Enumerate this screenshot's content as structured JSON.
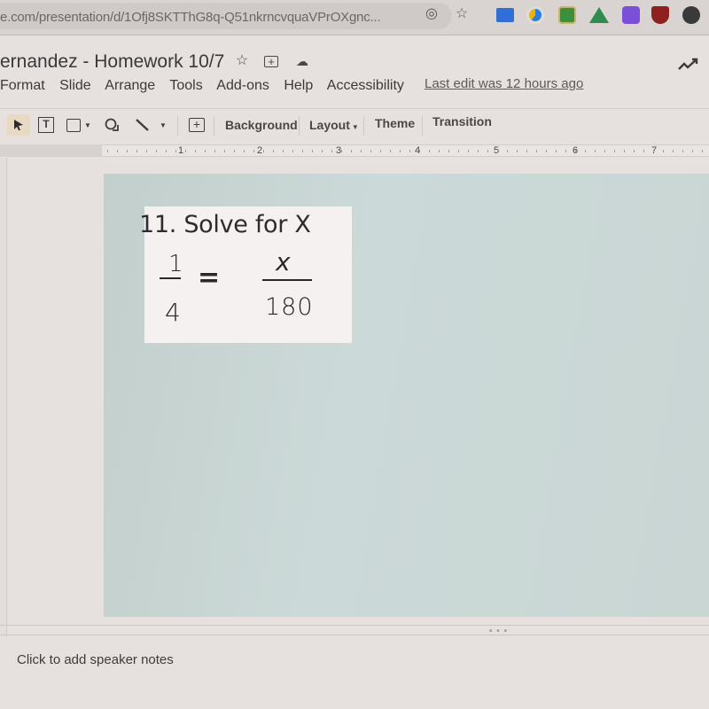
{
  "browser": {
    "url": "e.com/presentation/d/1Ofj8SKTThG8q-Q51nkrncvquaVPrOXgnc...",
    "extensions": [
      {
        "name": "google-classroom-like-blue",
        "color": "#2f6fd6"
      },
      {
        "name": "speedometer-extension",
        "color": "#2b7fd6"
      },
      {
        "name": "google-classroom",
        "color": "#3d8f3b"
      },
      {
        "name": "google-drive",
        "color": "#f0b400"
      },
      {
        "name": "puzzle-extension",
        "color": "#7b4fd8"
      },
      {
        "name": "ublock-origin",
        "color": "#8e2020"
      },
      {
        "name": "circle-extension",
        "color": "#3a3a3a"
      }
    ]
  },
  "app": {
    "doc_title": "ernandez - Homework 10/7",
    "menu": [
      "Format",
      "Slide",
      "Arrange",
      "Tools",
      "Add-ons",
      "Help",
      "Accessibility"
    ],
    "last_edit": "Last edit was 12 hours ago"
  },
  "toolbar": {
    "background_label": "Background",
    "layout_label": "Layout",
    "theme_label": "Theme",
    "transition_label": "Transition"
  },
  "ruler": {
    "numbers": [
      "1",
      "2",
      "3",
      "4",
      "5",
      "6",
      "7"
    ]
  },
  "slide": {
    "background_color": "#c8d6d4",
    "problem_title": "11. Solve for X",
    "equation": {
      "left_numerator": "1",
      "left_denominator": "4",
      "equals": "=",
      "right_numerator": "x",
      "right_denominator": "180"
    }
  },
  "notes": {
    "placeholder": "Click to add speaker notes"
  }
}
